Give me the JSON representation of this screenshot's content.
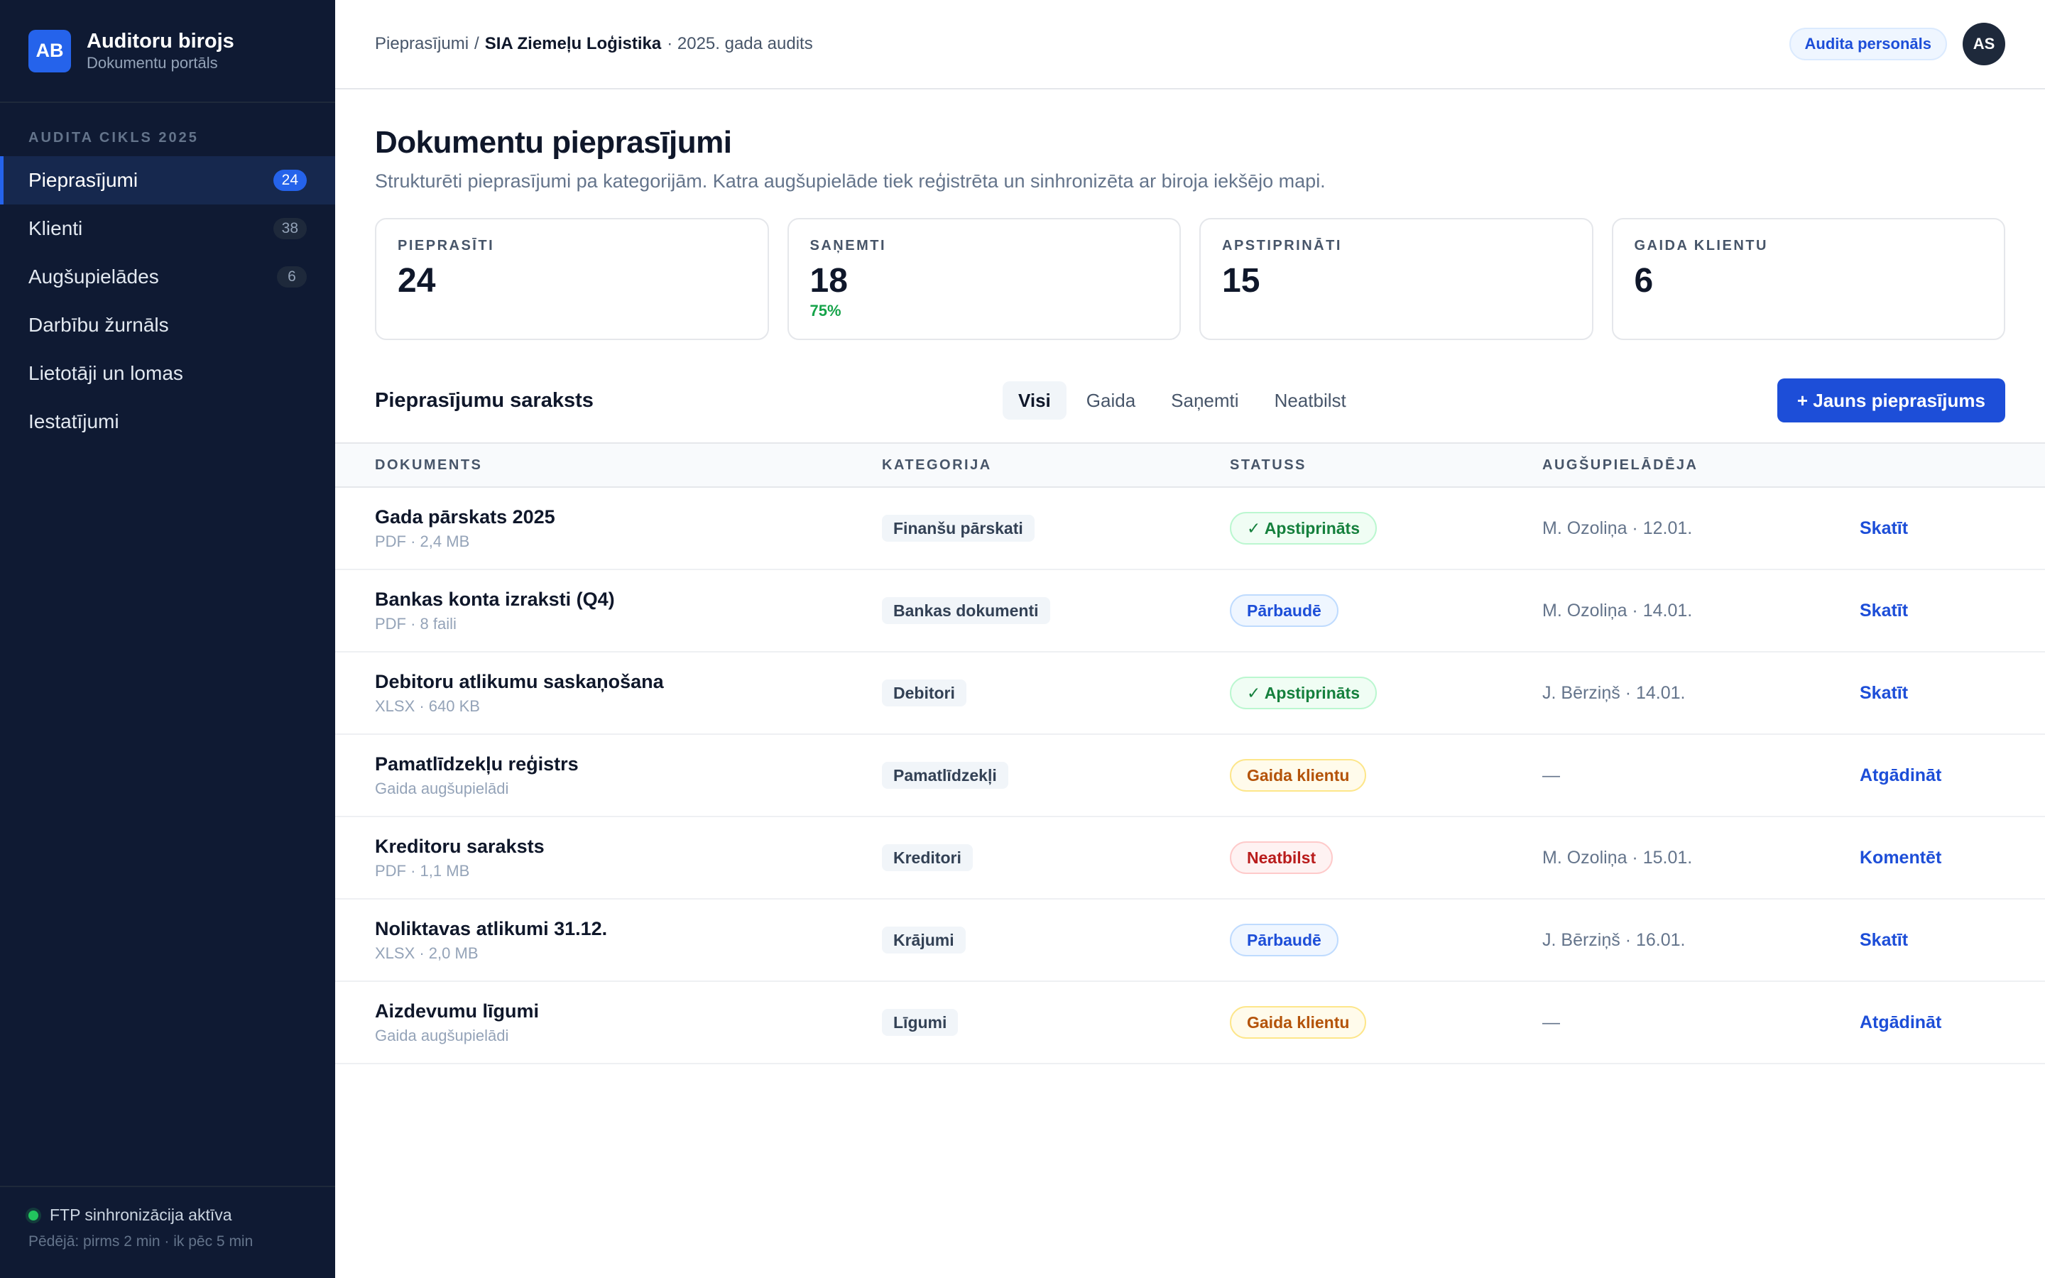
{
  "sidebar": {
    "logo": "AB",
    "title": "Auditoru birojs",
    "subtitle": "Dokumentu portāls",
    "section": "AUDITA CIKLS 2025",
    "items": [
      {
        "label": "Pieprasījumi",
        "count": "24"
      },
      {
        "label": "Klienti",
        "count": "38"
      },
      {
        "label": "Augšupielādes",
        "count": "6"
      },
      {
        "label": "Darbību žurnāls",
        "count": ""
      },
      {
        "label": "Lietotāji un lomas",
        "count": ""
      },
      {
        "label": "Iestatījumi",
        "count": ""
      }
    ],
    "sync_status": "FTP sinhronizācija aktīva",
    "sync_detail": "Pēdējā: pirms 2 min · ik pēc 5 min"
  },
  "topbar": {
    "crumb_root": "Pieprasījumi",
    "crumb_sep": "/",
    "crumb_client": "SIA Ziemeļu Loģistika",
    "crumb_context": "· 2025. gada audits",
    "role": "Audita personāls",
    "avatar": "AS"
  },
  "page": {
    "title": "Dokumentu pieprasījumi",
    "subtitle": "Strukturēti pieprasījumi pa kategorijām. Katra augšupielāde tiek reģistrēta un sinhronizēta ar biroja iekšējo mapi."
  },
  "stats": [
    {
      "label": "PIEPRASĪTI",
      "value": "24",
      "pct": ""
    },
    {
      "label": "SAŅEMTI",
      "value": "18",
      "pct": "75%"
    },
    {
      "label": "APSTIPRINĀTI",
      "value": "15",
      "pct": ""
    },
    {
      "label": "GAIDA KLIENTU",
      "value": "6",
      "pct": ""
    }
  ],
  "list": {
    "title": "Pieprasījumu saraksts",
    "filters": [
      "Visi",
      "Gaida",
      "Saņemti",
      "Neatbilst"
    ],
    "new_button": "+ Jauns pieprasījums"
  },
  "table": {
    "headers": [
      "DOKUMENTS",
      "KATEGORIJA",
      "STATUSS",
      "AUGŠUPIELĀDĒJA"
    ],
    "rows": [
      {
        "name": "Gada pārskats 2025",
        "meta": "PDF · 2,4 MB",
        "category": "Finanšu pārskati",
        "status": "✓ Apstiprināts",
        "status_type": "ok",
        "uploader": "M. Ozoliņa · 12.01.",
        "action": "Skatīt"
      },
      {
        "name": "Bankas konta izraksti (Q4)",
        "meta": "PDF · 8 faili",
        "category": "Bankas dokumenti",
        "status": "Pārbaudē",
        "status_type": "review",
        "uploader": "M. Ozoliņa · 14.01.",
        "action": "Skatīt"
      },
      {
        "name": "Debitoru atlikumu saskaņošana",
        "meta": "XLSX · 640 KB",
        "category": "Debitori",
        "status": "✓ Apstiprināts",
        "status_type": "ok",
        "uploader": "J. Bērziņš · 14.01.",
        "action": "Skatīt"
      },
      {
        "name": "Pamatlīdzekļu reģistrs",
        "meta": "Gaida augšupielādi",
        "category": "Pamatlīdzekļi",
        "status": "Gaida klientu",
        "status_type": "wait",
        "uploader": "—",
        "action": "Atgādināt"
      },
      {
        "name": "Kreditoru saraksts",
        "meta": "PDF · 1,1 MB",
        "category": "Kreditori",
        "status": "Neatbilst",
        "status_type": "bad",
        "uploader": "M. Ozoliņa · 15.01.",
        "action": "Komentēt"
      },
      {
        "name": "Noliktavas atlikumi 31.12.",
        "meta": "XLSX · 2,0 MB",
        "category": "Krājumi",
        "status": "Pārbaudē",
        "status_type": "review",
        "uploader": "J. Bērziņš · 16.01.",
        "action": "Skatīt"
      },
      {
        "name": "Aizdevumu līgumi",
        "meta": "Gaida augšupielādi",
        "category": "Līgumi",
        "status": "Gaida klientu",
        "status_type": "wait",
        "uploader": "—",
        "action": "Atgādināt"
      }
    ]
  },
  "colors": {
    "sidebar_bg": "#0f1a33",
    "accent": "#1d4ed8",
    "ok": "#15803d",
    "review": "#1d4ed8",
    "wait": "#b45309",
    "bad": "#b91c1c"
  }
}
